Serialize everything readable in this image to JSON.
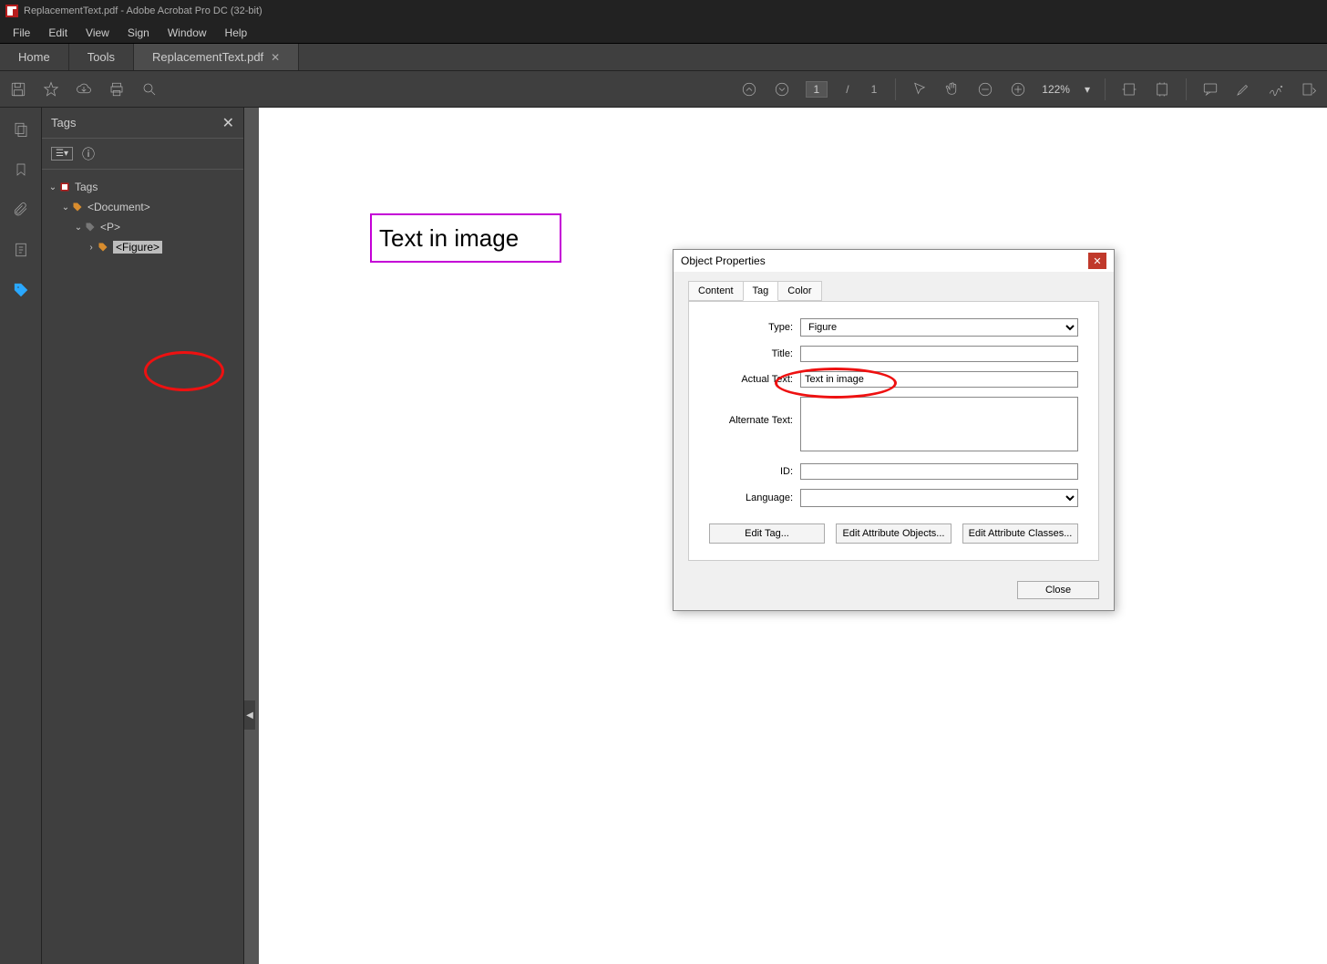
{
  "window_title": "ReplacementText.pdf - Adobe Acrobat Pro DC (32-bit)",
  "menu": {
    "file": "File",
    "edit": "Edit",
    "view": "View",
    "sign": "Sign",
    "window": "Window",
    "help": "Help"
  },
  "tabs": {
    "home": "Home",
    "tools": "Tools",
    "doc": "ReplacementText.pdf"
  },
  "toolbar": {
    "page_current": "1",
    "page_sep": "/",
    "page_total": "1",
    "zoom": "122%"
  },
  "tags_panel": {
    "title": "Tags",
    "root": "Tags",
    "doc": "<Document>",
    "p": "<P>",
    "figure": "<Figure>"
  },
  "page_text": "Text in image",
  "dialog": {
    "title": "Object Properties",
    "tab_content": "Content",
    "tab_tag": "Tag",
    "tab_color": "Color",
    "label_type": "Type:",
    "label_title": "Title:",
    "label_actual": "Actual Text:",
    "label_alt": "Alternate Text:",
    "label_id": "ID:",
    "label_lang": "Language:",
    "type_value": "Figure",
    "title_value": "",
    "actual_value": "Text in image",
    "alt_value": "",
    "id_value": "",
    "lang_value": "",
    "edit_tag": "Edit Tag...",
    "edit_attr_obj": "Edit Attribute Objects...",
    "edit_attr_cls": "Edit Attribute Classes...",
    "close": "Close"
  }
}
